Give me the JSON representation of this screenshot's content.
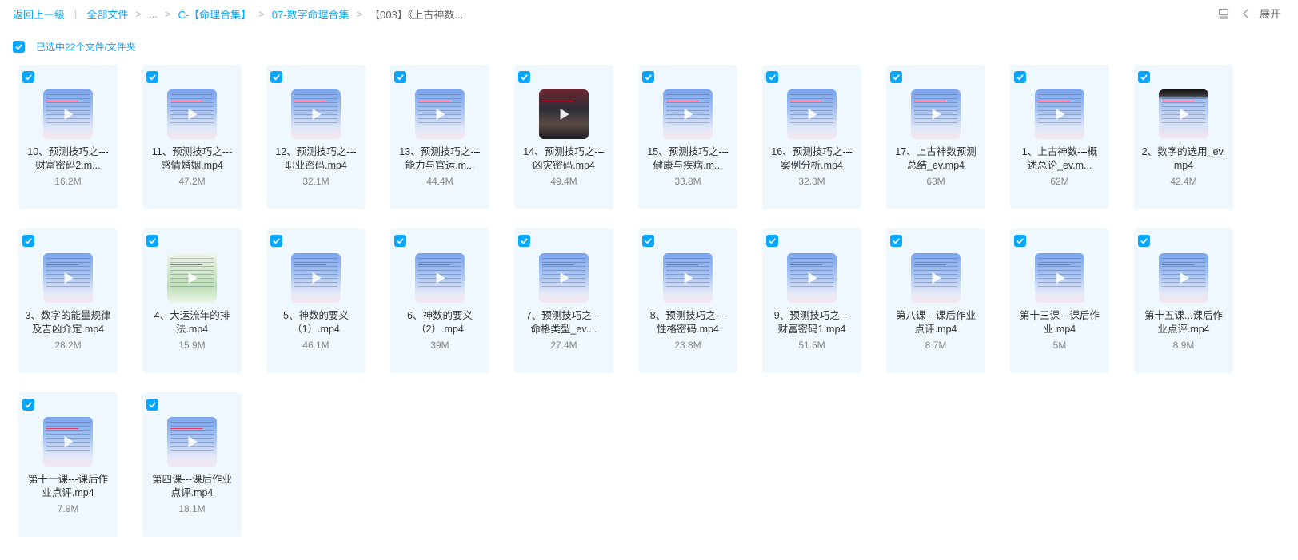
{
  "breadcrumb": {
    "back": "返回上一级",
    "all_files": "全部文件",
    "ellipsis": "...",
    "c1": "C-【命理合集】",
    "c2": "07-数字命理合集",
    "current": "【003】《上古神数..."
  },
  "toolbar": {
    "view_icon": "list-view-icon",
    "collapse_icon": "chevron-left-icon",
    "expand_label": "展开"
  },
  "selection": {
    "text": "已选中22个文件/文件夹",
    "all_checked": true
  },
  "colors": {
    "accent": "#06a7ff",
    "card_bg": "#eff8fe"
  },
  "files": [
    {
      "line1": "10、预测技巧之---",
      "line2": "财富密码2.m...",
      "size": "16.2M",
      "thumb": "blue"
    },
    {
      "line1": "11、预测技巧之---",
      "line2": "感情婚姻.mp4",
      "size": "47.2M",
      "thumb": "blue"
    },
    {
      "line1": "12、预测技巧之---",
      "line2": "职业密码.mp4",
      "size": "32.1M",
      "thumb": "blue"
    },
    {
      "line1": "13、预测技巧之---",
      "line2": "能力与官运.m...",
      "size": "44.4M",
      "thumb": "blue"
    },
    {
      "line1": "14、预测技巧之---",
      "line2": "凶灾密码.mp4",
      "size": "49.4M",
      "thumb": "dark"
    },
    {
      "line1": "15、预测技巧之---",
      "line2": "健康与疾病.m...",
      "size": "33.8M",
      "thumb": "blue"
    },
    {
      "line1": "16、预测技巧之---",
      "line2": "案例分析.mp4",
      "size": "32.3M",
      "thumb": "blue"
    },
    {
      "line1": "17、上古神数预测",
      "line2": "总结_ev.mp4",
      "size": "63M",
      "thumb": "blue"
    },
    {
      "line1": "1、上古神数---概",
      "line2": "述总论_ev.m...",
      "size": "62M",
      "thumb": "blue"
    },
    {
      "line1": "2、数字的选用_ev.",
      "line2": "mp4",
      "size": "42.4M",
      "thumb": "black-top"
    },
    {
      "line1": "3、数字的能量规律",
      "line2": "及吉凶介定.mp4",
      "size": "28.2M",
      "thumb": "blue"
    },
    {
      "line1": "4、大运流年的排",
      "line2": "法.mp4",
      "size": "15.9M",
      "thumb": "green"
    },
    {
      "line1": "5、神数的要义",
      "line2": "（1）.mp4",
      "size": "46.1M",
      "thumb": "blue"
    },
    {
      "line1": "6、神数的要义",
      "line2": "（2）.mp4",
      "size": "39M",
      "thumb": "blue"
    },
    {
      "line1": "7、预测技巧之---",
      "line2": "命格类型_ev....",
      "size": "27.4M",
      "thumb": "blue"
    },
    {
      "line1": "8、预测技巧之---",
      "line2": "性格密码.mp4",
      "size": "23.8M",
      "thumb": "blue"
    },
    {
      "line1": "9、预测技巧之---",
      "line2": "财富密码1.mp4",
      "size": "51.5M",
      "thumb": "blue"
    },
    {
      "line1": "第八课---课后作业",
      "line2": "点评.mp4",
      "size": "8.7M",
      "thumb": "blue"
    },
    {
      "line1": "第十三课---课后作",
      "line2": "业.mp4",
      "size": "5M",
      "thumb": "blue"
    },
    {
      "line1": "第十五课...课后作",
      "line2": "业点评.mp4",
      "size": "8.9M",
      "thumb": "blue"
    },
    {
      "line1": "第十一课---课后作",
      "line2": "业点评.mp4",
      "size": "7.8M",
      "thumb": "blue"
    },
    {
      "line1": "第四课---课后作业",
      "line2": "点评.mp4",
      "size": "18.1M",
      "thumb": "blue"
    }
  ]
}
